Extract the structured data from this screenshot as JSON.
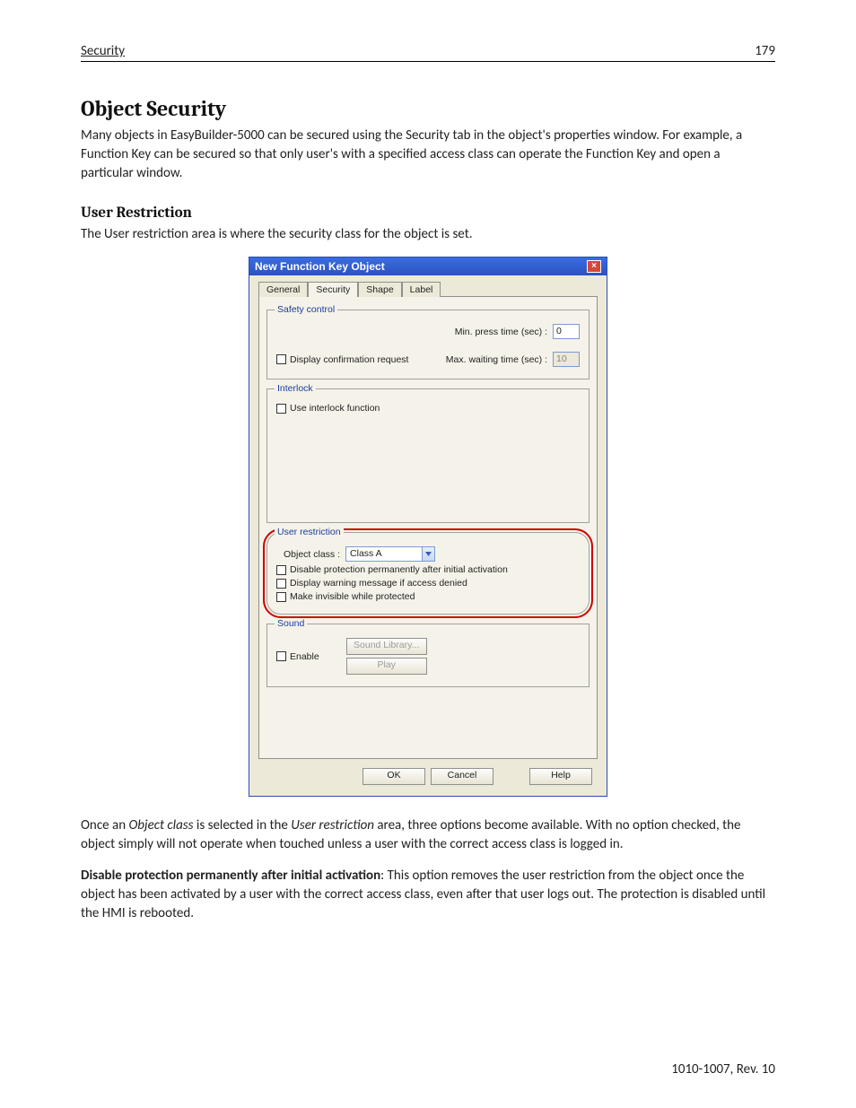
{
  "header": {
    "left": "Security",
    "right": "179"
  },
  "h1": "Object Security",
  "p1": "Many objects in EasyBuilder-5000 can be secured using the Security tab in the object's properties window. For example, a Function Key can be secured so that only user's with a specified access class can operate the Function Key and open a particular window.",
  "h2": "User Restriction",
  "p2": "The User restriction area is where the security class for the object is set.",
  "dialog": {
    "title": "New  Function Key Object",
    "tabs": [
      "General",
      "Security",
      "Shape",
      "Label"
    ],
    "safety": {
      "legend": "Safety control",
      "min_label": "Min. press time (sec) :",
      "min_value": "0",
      "confirm_label": "Display confirmation request",
      "max_label": "Max. waiting time (sec) :",
      "max_value": "10"
    },
    "interlock": {
      "legend": "Interlock",
      "use_label": "Use interlock function"
    },
    "restriction": {
      "legend": "User restriction",
      "class_label": "Object class :",
      "class_value": "Class A",
      "disable_label": "Disable protection permanently after initial activation",
      "warn_label": "Display warning message if access denied",
      "invis_label": "Make invisible while protected"
    },
    "sound": {
      "legend": "Sound",
      "enable_label": "Enable",
      "lib_label": "Sound Library...",
      "play_label": "Play"
    },
    "buttons": {
      "ok": "OK",
      "cancel": "Cancel",
      "help": "Help"
    }
  },
  "p3a": "Once an ",
  "p3b": "Object class",
  "p3c": " is selected in the ",
  "p3d": "User restriction",
  "p3e": " area, three options become available. With no option checked, the object simply will not operate when touched unless a user with the correct access class is logged in.",
  "p4a": "Disable protection permanently after initial activation",
  "p4b": ": This option removes the user restriction from the object once the object has been activated by a user with the correct access class, even after that user logs out. The protection is disabled until the HMI is rebooted.",
  "footer": "1010-1007, Rev. 10"
}
